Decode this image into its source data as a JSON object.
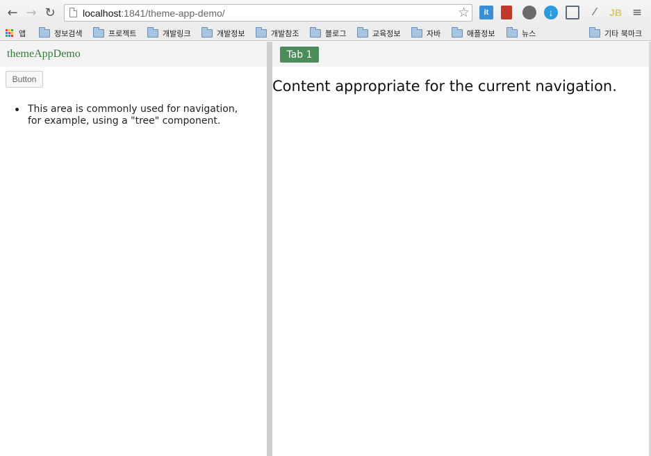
{
  "browser": {
    "url_host": "localhost",
    "url_path": ":1841/theme-app-demo/",
    "bookmarks": [
      {
        "label": "앱",
        "kind": "apps"
      },
      {
        "label": "정보검색",
        "kind": "folder"
      },
      {
        "label": "프로젝트",
        "kind": "folder"
      },
      {
        "label": "개발링크",
        "kind": "folder"
      },
      {
        "label": "개발정보",
        "kind": "folder"
      },
      {
        "label": "개발참조",
        "kind": "folder"
      },
      {
        "label": "블로그",
        "kind": "folder"
      },
      {
        "label": "교육정보",
        "kind": "folder"
      },
      {
        "label": "자바",
        "kind": "folder"
      },
      {
        "label": "애플정보",
        "kind": "folder"
      },
      {
        "label": "뉴스",
        "kind": "folder"
      }
    ],
    "other_bookmarks": "기타 북마크",
    "extensions": [
      {
        "name": "it-extension-icon",
        "label": "it",
        "color": "#3a8fd6"
      },
      {
        "name": "bookmark-extension-icon",
        "label": "",
        "color": "#c0392b"
      },
      {
        "name": "evernote-extension-icon",
        "label": "",
        "color": "#6a6a6a"
      },
      {
        "name": "download-extension-icon",
        "label": "↓",
        "color": "#2b9be0"
      },
      {
        "name": "screenshot-extension-icon",
        "label": "",
        "color": "#5a6a7a"
      },
      {
        "name": "eyedropper-extension-icon",
        "label": "",
        "color": "#888888"
      },
      {
        "name": "jb-extension-icon",
        "label": "JB",
        "color": "#e6d98a"
      }
    ]
  },
  "app": {
    "title": "themeAppDemo",
    "button_label": "Button",
    "nav_text": "This area is commonly used for navigation, for example, using a \"tree\" component.",
    "tab_label": "Tab 1",
    "content_text": "Content appropriate for the current navigation.",
    "accent_color": "#4c8b5a",
    "title_color": "#2f7a3a"
  }
}
